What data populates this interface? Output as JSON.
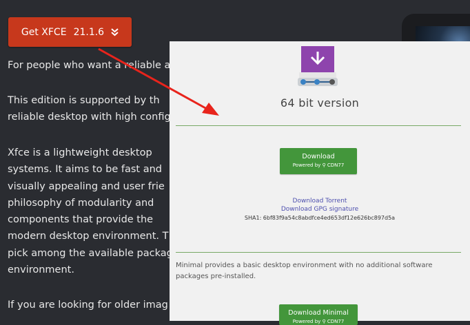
{
  "get_button": {
    "label": "Get XFCE",
    "version": "21.1.6",
    "icon": "double-chevron-down-icon"
  },
  "background_text": [
    "For people who want a reliable a",
    "This edition is supported by th",
    "reliable desktop with high config",
    "Xfce is a lightweight desktop",
    "systems. It aims to be fast and",
    "visually appealing and user frie",
    "philosophy of modularity and",
    "components that provide the",
    "modern desktop environment. T",
    "pick among the available packag",
    "environment.",
    "If you are looking for older imag"
  ],
  "panel": {
    "icon": "download-drive-icon",
    "title": "64 bit version",
    "download_button": {
      "label": "Download",
      "sub": "Powered by ⚲ CDN77"
    },
    "torrent_link": "Download Torrent",
    "gpg_link": "Download GPG signature",
    "sha": "SHA1: 6bf83f9a54c8abdfce4ed653df12e626bc897d5a",
    "minimal_text": "Minimal provides a basic desktop environment with no additional software packages pre-installed.",
    "minimal_button": {
      "label": "Download Minimal",
      "sub": "Powered by ⚲ CDN77"
    }
  },
  "colors": {
    "accent_red": "#c7381c",
    "green": "#43963b",
    "link": "#4d4fae",
    "arrow": "#e8241c"
  }
}
